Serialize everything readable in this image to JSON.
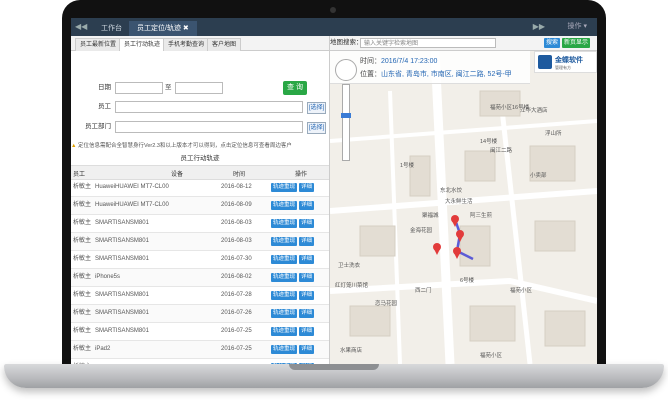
{
  "topbar": {
    "tabs": [
      {
        "label": "工作台"
      },
      {
        "label": "员工定位/轨迹"
      }
    ],
    "ops_label": "操作"
  },
  "subtabs": [
    "员工最新位置",
    "员工行动轨迹",
    "手机考勤查询",
    "客户地图"
  ],
  "form": {
    "date_label": "日期",
    "to_label": "至",
    "employee_label": "员工",
    "dept_label": "员工部门",
    "select_link": "[选择]",
    "query_button": "查 询"
  },
  "notice": "定位信息需配合全智慧身行Ver2.3和以上版本才可以得到，点击定位信息可查看周边客户",
  "table": {
    "title": "员工行动轨迹",
    "headers": {
      "employee": "员工",
      "device": "设备",
      "time": "时间",
      "ops": "操作"
    },
    "track_label": "轨迹重现",
    "detail_label": "详细",
    "rows": [
      {
        "employee": "析敏主",
        "device": "HuaweiHUAWEI MT7-CL00",
        "time": "2016-08-12"
      },
      {
        "employee": "析敏主",
        "device": "HuaweiHUAWEI MT7-CL00",
        "time": "2016-08-09"
      },
      {
        "employee": "析敏主",
        "device": "SMARTISANSM801",
        "time": "2016-08-03"
      },
      {
        "employee": "析敏主",
        "device": "SMARTISANSM801",
        "time": "2016-08-03"
      },
      {
        "employee": "析敏主",
        "device": "SMARTISANSM801",
        "time": "2016-07-30"
      },
      {
        "employee": "析敏主",
        "device": "iPhone5s",
        "time": "2016-08-02"
      },
      {
        "employee": "析敏主",
        "device": "SMARTISANSM801",
        "time": "2016-07-28"
      },
      {
        "employee": "析敏主",
        "device": "SMARTISANSM801",
        "time": "2016-07-26"
      },
      {
        "employee": "析敏主",
        "device": "SMARTISANSM801",
        "time": "2016-07-25"
      },
      {
        "employee": "析敏主",
        "device": "iPad2",
        "time": "2016-07-25"
      },
      {
        "employee": "析敏主",
        "device": "XiaomiMI2",
        "time": "2016-07-24"
      }
    ]
  },
  "map": {
    "search_label": "地图搜索：",
    "search_placeholder": "输入关键字检索地图",
    "search_button": "搜索",
    "fullscreen_button": "新页显示",
    "info": {
      "time_label": "时间：",
      "time_value": "2016/7/4 17:23:00",
      "loc_label": "位置：",
      "loc_value": "山东省, 青岛市, 市南区, 闽江二路, 52号-甲"
    },
    "logo": {
      "name": "金蝶软件",
      "sub": "管理有方"
    },
    "labels": [
      "福苑小区16号楼",
      "福苑小区",
      "1号楼",
      "14号楼",
      "大永鲜生活",
      "卫士洗衣",
      "红灯笼川菜馆",
      "恋马花园",
      "西二门",
      "聚福城",
      "6号楼",
      "福苑小区",
      "江华大酒店",
      "水果商店",
      "浮山所",
      "东北水饺",
      "阿三生煎",
      "闽江二路",
      "金海花园",
      "小卖部"
    ],
    "route_color": "#5b5bd6",
    "marker_color": "#e23b3b"
  }
}
